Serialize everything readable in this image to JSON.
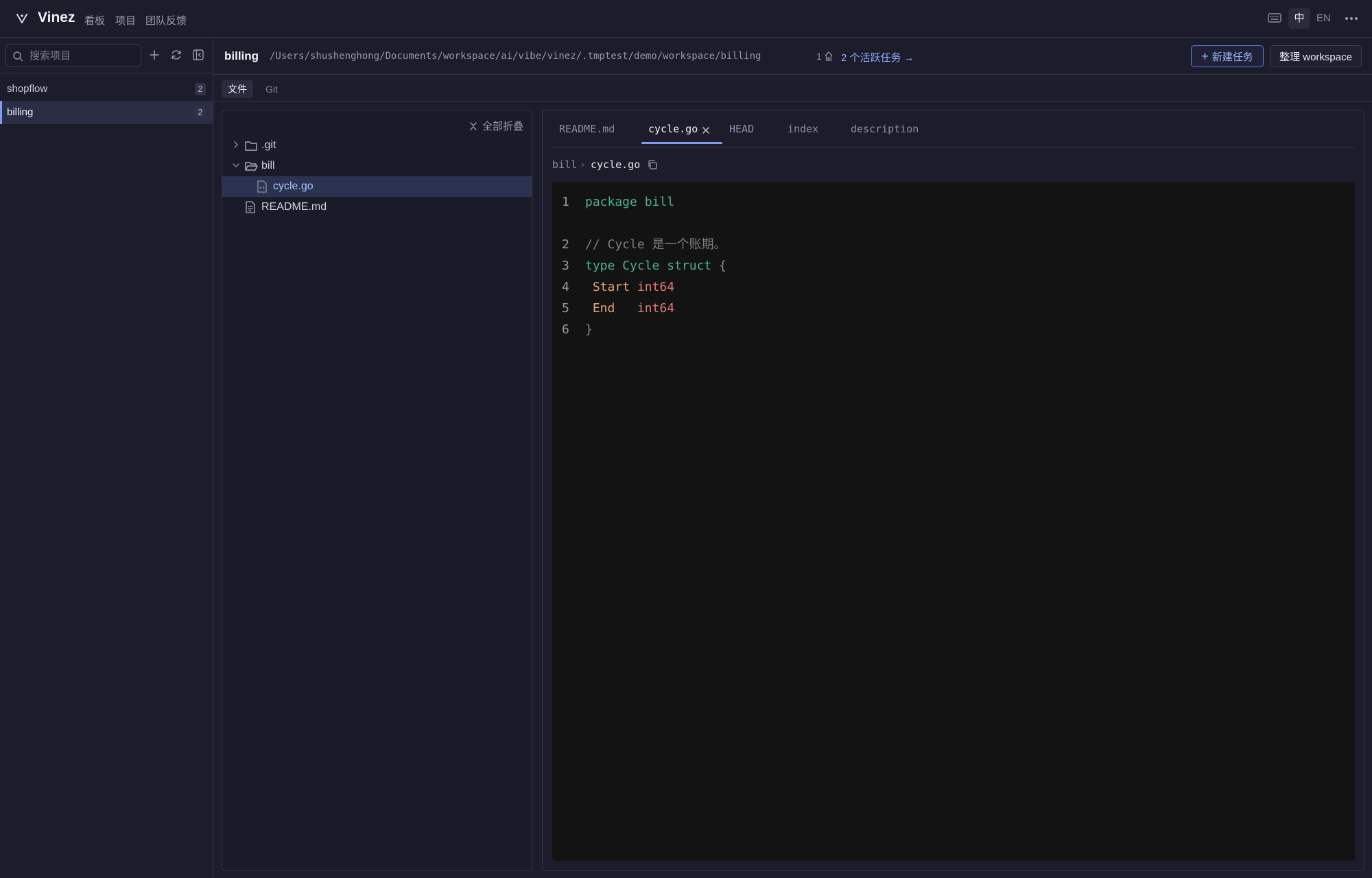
{
  "app": {
    "title": "Vinez",
    "nav": [
      "看板",
      "项目",
      "团队反馈"
    ],
    "lang_zh": "中",
    "lang_en": "EN"
  },
  "sidebar": {
    "search_placeholder": "搜索项目",
    "projects": [
      {
        "label": "shopflow",
        "count": "2",
        "active": false
      },
      {
        "label": "billing",
        "count": "2",
        "active": true
      }
    ]
  },
  "main": {
    "title": "billing",
    "path": "/Users/shushenghong/Documents/workspace/ai/vibe/vinez/.tmptest/demo/workspace/billing",
    "branch_count": "1",
    "active_tasks": "2 个活跃任务 →",
    "new_task_label": "新建任务",
    "organize_label": "整理 workspace",
    "subtabs": [
      "文件",
      "Git"
    ]
  },
  "tree": {
    "collapse_all": "全部折叠",
    "items": [
      {
        "name": ".git",
        "type": "folder",
        "expanded": false,
        "level": 0
      },
      {
        "name": "bill",
        "type": "folder",
        "expanded": true,
        "level": 0
      },
      {
        "name": "cycle.go",
        "type": "code-file",
        "level": 1,
        "selected": true
      },
      {
        "name": "README.md",
        "type": "text-file",
        "level": 0
      }
    ]
  },
  "editor": {
    "tabs": [
      "README.md",
      "cycle.go",
      "HEAD",
      "index",
      "description"
    ],
    "active_tab": "cycle.go",
    "breadcrumb_dir": "bill",
    "breadcrumb_sep": "›",
    "breadcrumb_file": "cycle.go",
    "lines": [
      {
        "num": "1",
        "tokens": [
          [
            "kw",
            "package"
          ],
          [
            "",
            " "
          ],
          [
            "ty",
            "bill"
          ]
        ]
      },
      {
        "num": "2",
        "tokens": [
          [
            "cm",
            "// Cycle 是一个账期。"
          ]
        ]
      },
      {
        "num": "3",
        "tokens": [
          [
            "kw",
            "type"
          ],
          [
            "",
            " "
          ],
          [
            "ty",
            "Cycle"
          ],
          [
            "",
            " "
          ],
          [
            "kw",
            "struct"
          ],
          [
            "",
            " "
          ],
          [
            "punc",
            "{"
          ]
        ]
      },
      {
        "num": "4",
        "tokens": [
          [
            "",
            " "
          ],
          [
            "fld",
            "Start"
          ],
          [
            "",
            " "
          ],
          [
            "num",
            "int64"
          ]
        ]
      },
      {
        "num": "5",
        "tokens": [
          [
            "",
            " "
          ],
          [
            "fld",
            "End"
          ],
          [
            "",
            "   "
          ],
          [
            "num",
            "int64"
          ]
        ]
      },
      {
        "num": "6",
        "tokens": [
          [
            "punc",
            "}"
          ]
        ]
      }
    ]
  },
  "colors": {
    "accent": "#7e9cf0",
    "keyword": "#4fb08a",
    "comment": "#7d7d7d",
    "field": "#e3a27a",
    "type_builtin": "#e0787a"
  }
}
